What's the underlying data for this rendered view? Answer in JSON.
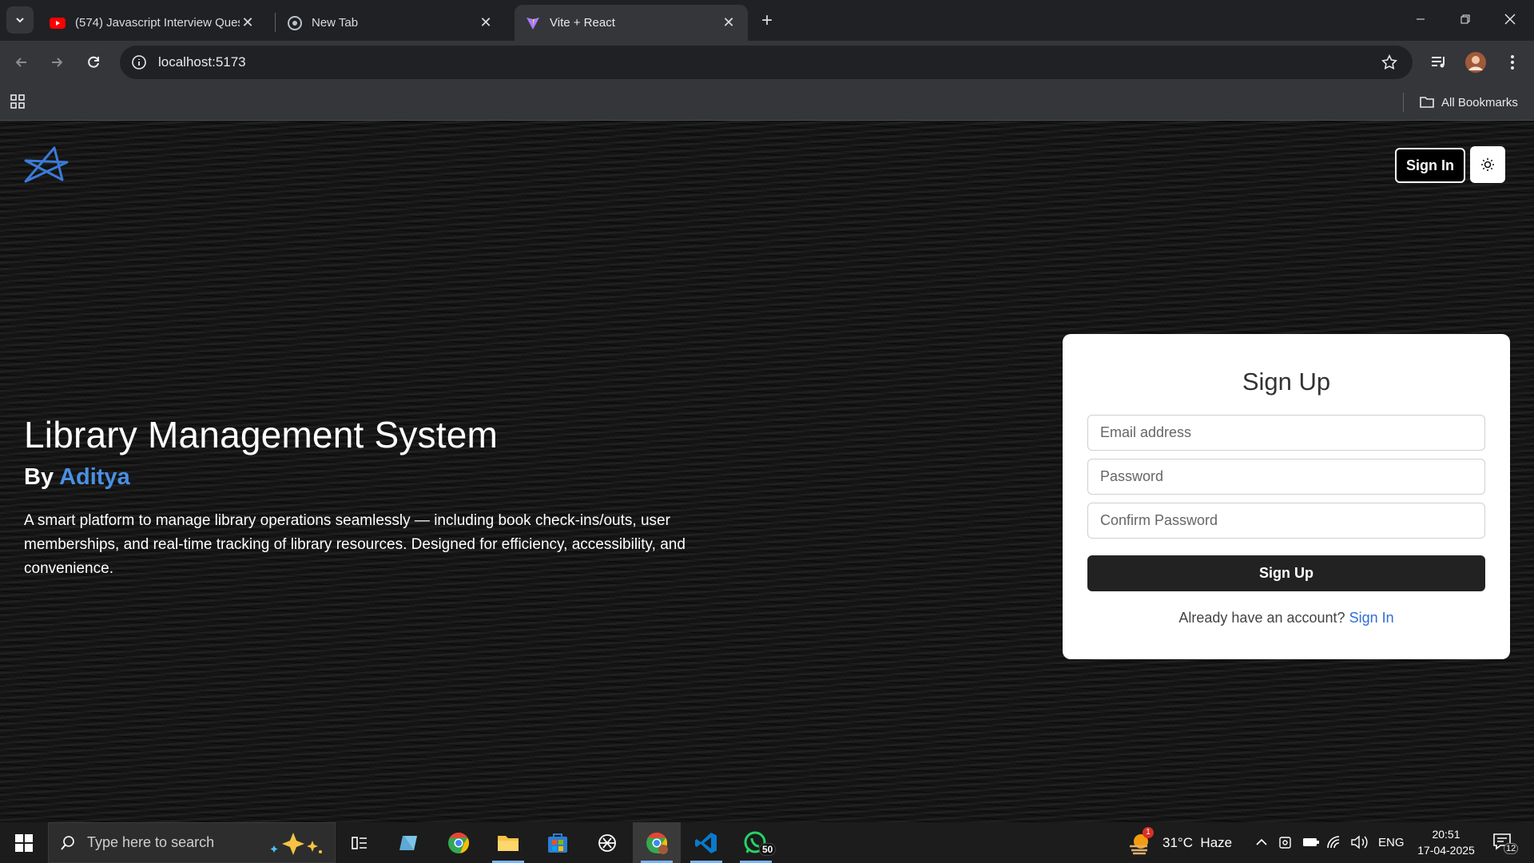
{
  "browser": {
    "tabs": [
      {
        "title": "(574) Javascript Interview Quest",
        "icon": "youtube-icon",
        "active": false
      },
      {
        "title": "New Tab",
        "icon": "chrome-icon",
        "active": false
      },
      {
        "title": "Vite + React",
        "icon": "vite-icon",
        "active": true
      }
    ],
    "url": "localhost:5173",
    "bookmarks_label": "All Bookmarks"
  },
  "page": {
    "nav": {
      "signin_label": "Sign In",
      "theme_icon": "sun-icon"
    },
    "hero": {
      "title": "Library Management System",
      "by_prefix": "By",
      "author": "Aditya",
      "description": "A smart platform to manage library operations seamlessly — including book check-ins/outs, user memberships, and real-time tracking of library resources. Designed for efficiency, accessibility, and convenience."
    },
    "signup_card": {
      "title": "Sign Up",
      "email_placeholder": "Email address",
      "password_placeholder": "Password",
      "confirm_placeholder": "Confirm Password",
      "submit_label": "Sign Up",
      "footer_text": "Already have an account?",
      "footer_link": "Sign In"
    },
    "colors": {
      "accent": "#4a90e2",
      "link": "#2f6fd6",
      "button": "#222222"
    }
  },
  "taskbar": {
    "search_placeholder": "Type here to search",
    "weather": "31°C  Haze",
    "weather_badge": "1",
    "language": "ENG",
    "time": "20:51",
    "date": "17-04-2025",
    "whatsapp_badge": "50",
    "notifications_badge": "12"
  }
}
